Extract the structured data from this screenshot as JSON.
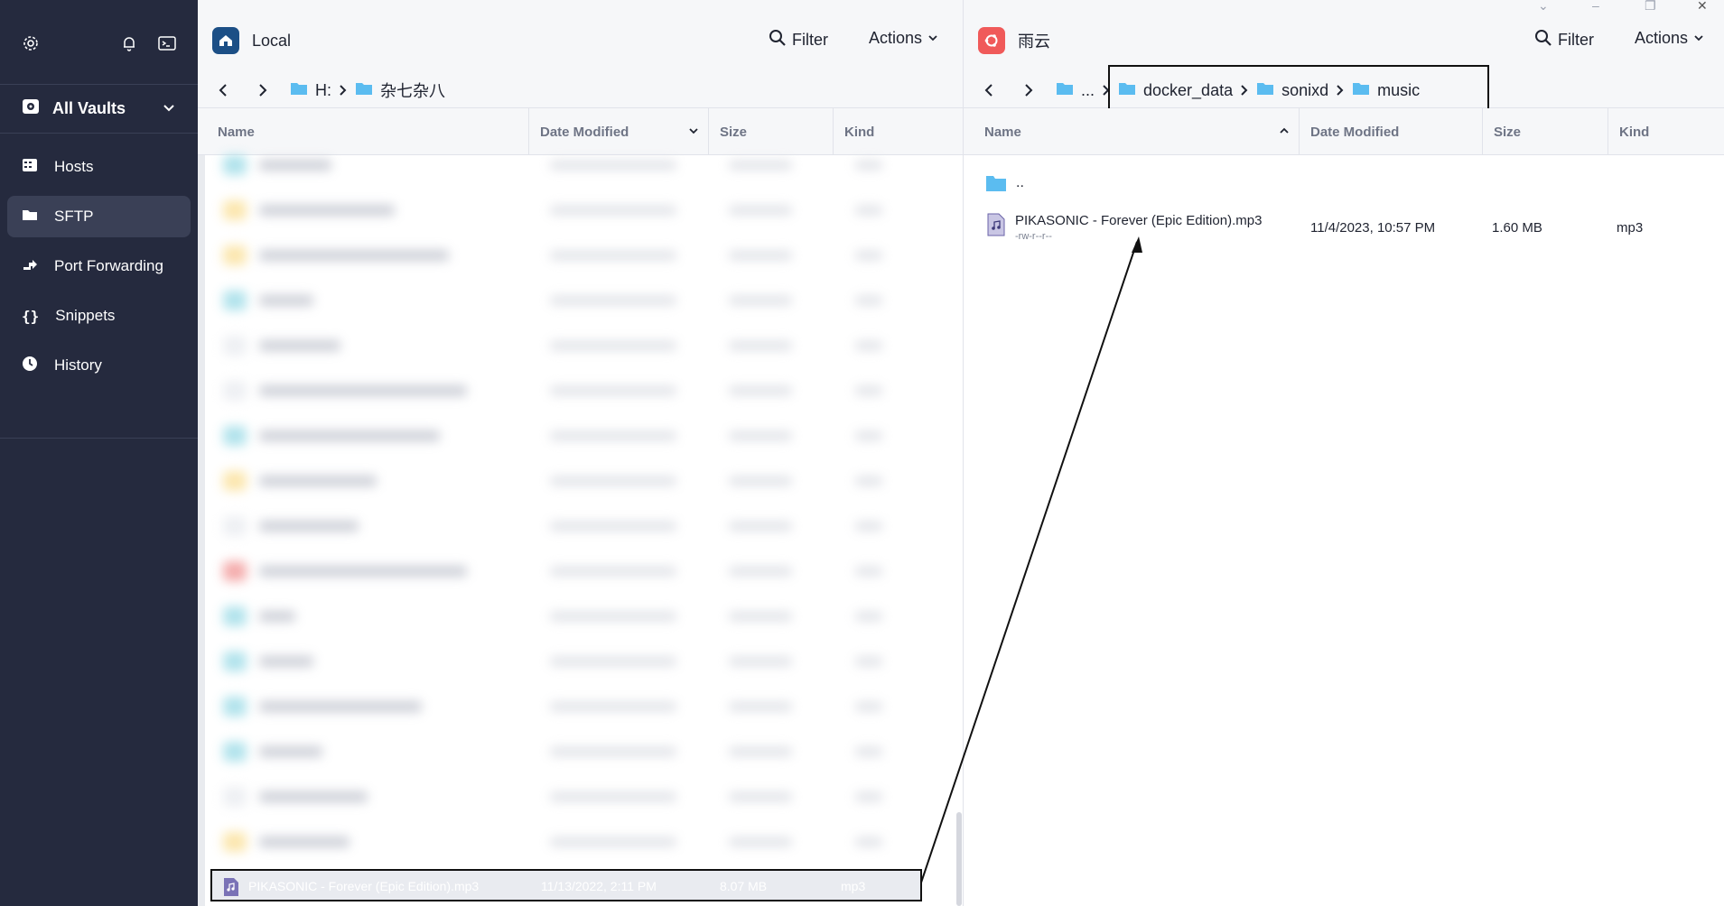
{
  "sidebar": {
    "vault_label": "All Vaults",
    "items": [
      {
        "label": "Hosts",
        "icon": "hosts-icon",
        "active": false
      },
      {
        "label": "SFTP",
        "icon": "folder-icon",
        "active": true
      },
      {
        "label": "Port Forwarding",
        "icon": "port-forward-icon",
        "active": false
      },
      {
        "label": "Snippets",
        "icon": "braces-icon",
        "active": false
      },
      {
        "label": "History",
        "icon": "clock-icon",
        "active": false
      }
    ]
  },
  "left": {
    "host_name": "Local",
    "filter_label": "Filter",
    "actions_label": "Actions",
    "breadcrumb": [
      "H:",
      "杂七杂八"
    ],
    "columns": [
      "Name",
      "Date Modified",
      "Size",
      "Kind"
    ],
    "selected_file": {
      "name": "PIKASONIC - Forever (Epic Edition).mp3",
      "date": "11/13/2022, 2:11 PM",
      "size": "8.07 MB",
      "kind": "mp3"
    }
  },
  "right": {
    "host_name": "雨云",
    "filter_label": "Filter",
    "actions_label": "Actions",
    "breadcrumb": [
      "...",
      "docker_data",
      "sonixd",
      "music"
    ],
    "columns": [
      "Name",
      "Date Modified",
      "Size",
      "Kind"
    ],
    "parent_label": "..",
    "files": [
      {
        "name": "PIKASONIC - Forever (Epic Edition).mp3",
        "perm": "-rw-r--r--",
        "date": "11/4/2023, 10:57 PM",
        "size": "1.60 MB",
        "kind": "mp3"
      }
    ]
  },
  "colors": {
    "sidebar_bg": "#252a3e",
    "local_badge": "#1c4f86",
    "remote_badge": "#f05a5a",
    "folder": "#5bbcf0"
  }
}
